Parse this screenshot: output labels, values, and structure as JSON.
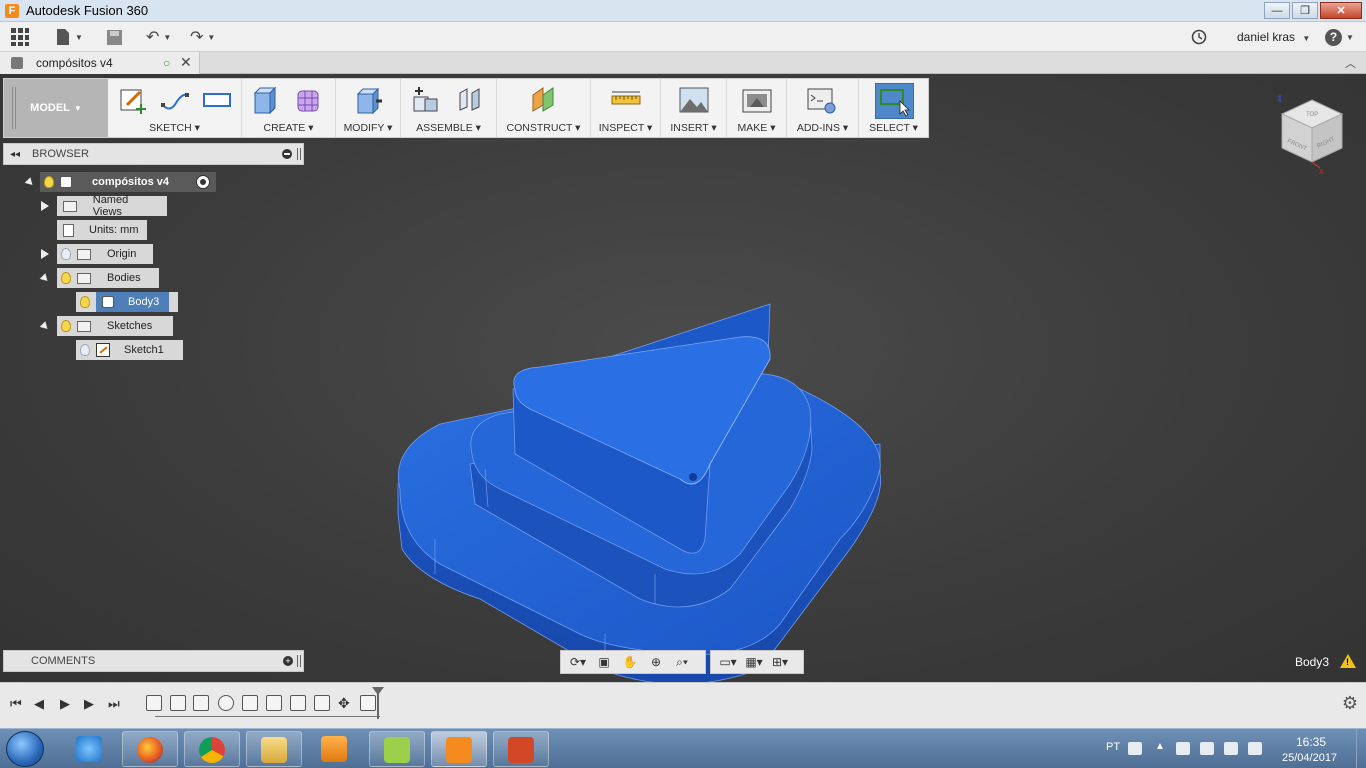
{
  "window": {
    "title": "Autodesk Fusion 360",
    "icon_letter": "F",
    "minimize": "—",
    "restore": "❐",
    "close": "✕"
  },
  "qat": {
    "user_name": "daniel kras",
    "help": "?"
  },
  "tab": {
    "name": "compósitos v4"
  },
  "toolbar": {
    "workspace": "MODEL",
    "groups": [
      {
        "label": "SKETCH"
      },
      {
        "label": "CREATE"
      },
      {
        "label": "MODIFY"
      },
      {
        "label": "ASSEMBLE"
      },
      {
        "label": "CONSTRUCT"
      },
      {
        "label": "INSPECT"
      },
      {
        "label": "INSERT"
      },
      {
        "label": "MAKE"
      },
      {
        "label": "ADD-INS"
      },
      {
        "label": "SELECT"
      }
    ]
  },
  "browser": {
    "title": "BROWSER",
    "root": "compósitos v4",
    "items": [
      {
        "label": "Named Views"
      },
      {
        "label": "Units: mm"
      },
      {
        "label": "Origin"
      },
      {
        "label": "Bodies"
      },
      {
        "label": "Body3"
      },
      {
        "label": "Sketches"
      },
      {
        "label": "Sketch1"
      }
    ]
  },
  "comments": {
    "title": "COMMENTS"
  },
  "status": {
    "selection": "Body3",
    "warning": "!"
  },
  "viewcube": {
    "front": "FRONT",
    "right": "RIGHT",
    "top": "TOP",
    "axis_z": "Z",
    "axis_x": "X"
  },
  "taskbar": {
    "language": "PT",
    "time": "16:35",
    "date": "25/04/2017"
  },
  "colors": {
    "model_blue": "#1f5fd0",
    "accent_select": "#4f88c8",
    "bulb_on": "#f6d64a"
  }
}
